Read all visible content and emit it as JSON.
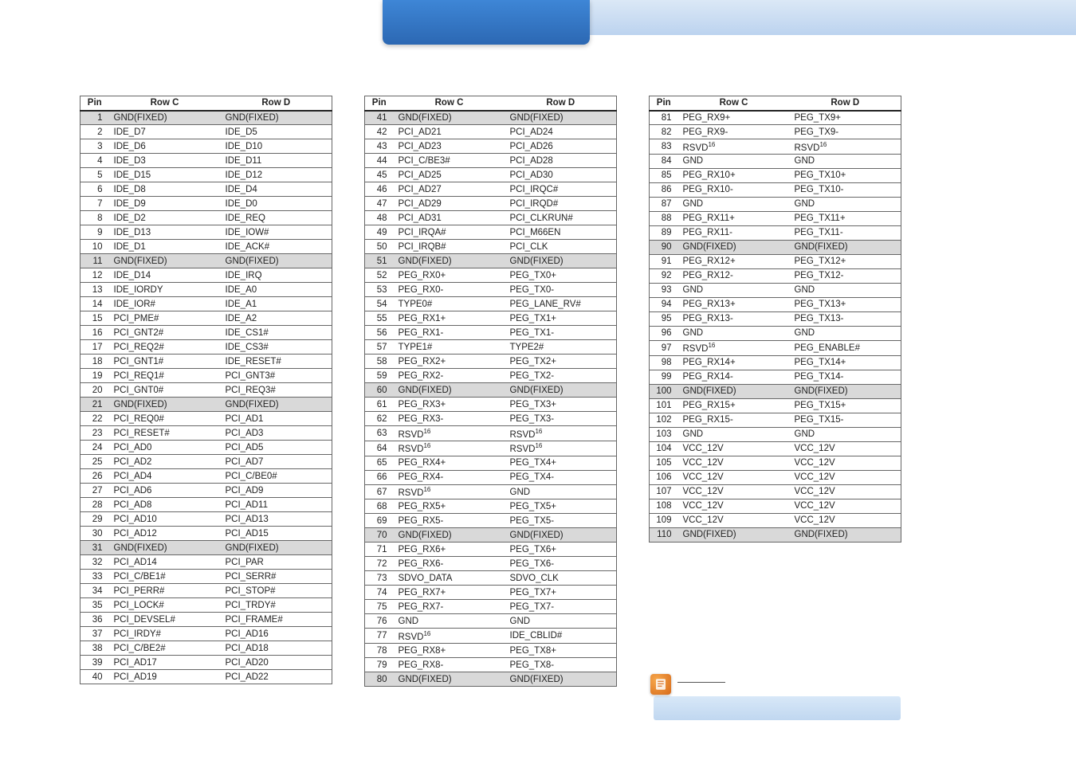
{
  "headers": {
    "pin": "Pin",
    "c": "Row C",
    "d": "Row D"
  },
  "table1": [
    {
      "p": 1,
      "c": "GND(FIXED)",
      "d": "GND(FIXED)",
      "s": 1
    },
    {
      "p": 2,
      "c": "IDE_D7",
      "d": "IDE_D5"
    },
    {
      "p": 3,
      "c": "IDE_D6",
      "d": "IDE_D10"
    },
    {
      "p": 4,
      "c": "IDE_D3",
      "d": "IDE_D11"
    },
    {
      "p": 5,
      "c": "IDE_D15",
      "d": "IDE_D12"
    },
    {
      "p": 6,
      "c": "IDE_D8",
      "d": "IDE_D4"
    },
    {
      "p": 7,
      "c": "IDE_D9",
      "d": "IDE_D0"
    },
    {
      "p": 8,
      "c": "IDE_D2",
      "d": "IDE_REQ"
    },
    {
      "p": 9,
      "c": "IDE_D13",
      "d": "IDE_IOW#"
    },
    {
      "p": 10,
      "c": "IDE_D1",
      "d": "IDE_ACK#"
    },
    {
      "p": 11,
      "c": "GND(FIXED)",
      "d": "GND(FIXED)",
      "s": 1
    },
    {
      "p": 12,
      "c": "IDE_D14",
      "d": "IDE_IRQ"
    },
    {
      "p": 13,
      "c": "IDE_IORDY",
      "d": "IDE_A0"
    },
    {
      "p": 14,
      "c": "IDE_IOR#",
      "d": "IDE_A1"
    },
    {
      "p": 15,
      "c": "PCI_PME#",
      "d": "IDE_A2"
    },
    {
      "p": 16,
      "c": "PCI_GNT2#",
      "d": "IDE_CS1#"
    },
    {
      "p": 17,
      "c": "PCI_REQ2#",
      "d": "IDE_CS3#"
    },
    {
      "p": 18,
      "c": "PCI_GNT1#",
      "d": "IDE_RESET#"
    },
    {
      "p": 19,
      "c": "PCI_REQ1#",
      "d": "PCI_GNT3#"
    },
    {
      "p": 20,
      "c": "PCI_GNT0#",
      "d": "PCI_REQ3#"
    },
    {
      "p": 21,
      "c": "GND(FIXED)",
      "d": "GND(FIXED)",
      "s": 1
    },
    {
      "p": 22,
      "c": "PCI_REQ0#",
      "d": "PCI_AD1"
    },
    {
      "p": 23,
      "c": "PCI_RESET#",
      "d": "PCI_AD3"
    },
    {
      "p": 24,
      "c": "PCI_AD0",
      "d": "PCI_AD5"
    },
    {
      "p": 25,
      "c": "PCI_AD2",
      "d": "PCI_AD7"
    },
    {
      "p": 26,
      "c": "PCI_AD4",
      "d": "PCI_C/BE0#"
    },
    {
      "p": 27,
      "c": "PCI_AD6",
      "d": "PCI_AD9"
    },
    {
      "p": 28,
      "c": "PCI_AD8",
      "d": "PCI_AD11"
    },
    {
      "p": 29,
      "c": "PCI_AD10",
      "d": "PCI_AD13"
    },
    {
      "p": 30,
      "c": "PCI_AD12",
      "d": "PCI_AD15"
    },
    {
      "p": 31,
      "c": "GND(FIXED)",
      "d": "GND(FIXED)",
      "s": 1
    },
    {
      "p": 32,
      "c": "PCI_AD14",
      "d": "PCI_PAR"
    },
    {
      "p": 33,
      "c": "PCI_C/BE1#",
      "d": "PCI_SERR#"
    },
    {
      "p": 34,
      "c": "PCI_PERR#",
      "d": "PCI_STOP#"
    },
    {
      "p": 35,
      "c": "PCI_LOCK#",
      "d": "PCI_TRDY#"
    },
    {
      "p": 36,
      "c": "PCI_DEVSEL#",
      "d": "PCI_FRAME#"
    },
    {
      "p": 37,
      "c": "PCI_IRDY#",
      "d": "PCI_AD16"
    },
    {
      "p": 38,
      "c": "PCI_C/BE2#",
      "d": "PCI_AD18"
    },
    {
      "p": 39,
      "c": "PCI_AD17",
      "d": "PCI_AD20"
    },
    {
      "p": 40,
      "c": "PCI_AD19",
      "d": "PCI_AD22"
    }
  ],
  "table2": [
    {
      "p": 41,
      "c": "GND(FIXED)",
      "d": "GND(FIXED)",
      "s": 1
    },
    {
      "p": 42,
      "c": "PCI_AD21",
      "d": "PCI_AD24"
    },
    {
      "p": 43,
      "c": "PCI_AD23",
      "d": "PCI_AD26"
    },
    {
      "p": 44,
      "c": "PCI_C/BE3#",
      "d": "PCI_AD28"
    },
    {
      "p": 45,
      "c": "PCI_AD25",
      "d": "PCI_AD30"
    },
    {
      "p": 46,
      "c": "PCI_AD27",
      "d": "PCI_IRQC#"
    },
    {
      "p": 47,
      "c": "PCI_AD29",
      "d": "PCI_IRQD#"
    },
    {
      "p": 48,
      "c": "PCI_AD31",
      "d": "PCI_CLKRUN#"
    },
    {
      "p": 49,
      "c": "PCI_IRQA#",
      "d": "PCI_M66EN"
    },
    {
      "p": 50,
      "c": "PCI_IRQB#",
      "d": "PCI_CLK"
    },
    {
      "p": 51,
      "c": "GND(FIXED)",
      "d": "GND(FIXED)",
      "s": 1
    },
    {
      "p": 52,
      "c": "PEG_RX0+",
      "d": "PEG_TX0+"
    },
    {
      "p": 53,
      "c": "PEG_RX0-",
      "d": "PEG_TX0-"
    },
    {
      "p": 54,
      "c": "TYPE0#",
      "d": "PEG_LANE_RV#"
    },
    {
      "p": 55,
      "c": "PEG_RX1+",
      "d": "PEG_TX1+"
    },
    {
      "p": 56,
      "c": "PEG_RX1-",
      "d": "PEG_TX1-"
    },
    {
      "p": 57,
      "c": "TYPE1#",
      "d": "TYPE2#"
    },
    {
      "p": 58,
      "c": "PEG_RX2+",
      "d": "PEG_TX2+"
    },
    {
      "p": 59,
      "c": "PEG_RX2-",
      "d": "PEG_TX2-"
    },
    {
      "p": 60,
      "c": "GND(FIXED)",
      "d": "GND(FIXED)",
      "s": 1
    },
    {
      "p": 61,
      "c": "PEG_RX3+",
      "d": "PEG_TX3+"
    },
    {
      "p": 62,
      "c": "PEG_RX3-",
      "d": "PEG_TX3-"
    },
    {
      "p": 63,
      "c": "RSVD",
      "d": "RSVD",
      "sup": "16"
    },
    {
      "p": 64,
      "c": "RSVD",
      "d": "RSVD",
      "sup": "16"
    },
    {
      "p": 65,
      "c": "PEG_RX4+",
      "d": "PEG_TX4+"
    },
    {
      "p": 66,
      "c": "PEG_RX4-",
      "d": "PEG_TX4-"
    },
    {
      "p": 67,
      "c": "RSVD",
      "d": "GND",
      "sup_c": "16"
    },
    {
      "p": 68,
      "c": "PEG_RX5+",
      "d": "PEG_TX5+"
    },
    {
      "p": 69,
      "c": "PEG_RX5-",
      "d": "PEG_TX5-"
    },
    {
      "p": 70,
      "c": "GND(FIXED)",
      "d": "GND(FIXED)",
      "s": 1
    },
    {
      "p": 71,
      "c": "PEG_RX6+",
      "d": "PEG_TX6+"
    },
    {
      "p": 72,
      "c": "PEG_RX6-",
      "d": "PEG_TX6-"
    },
    {
      "p": 73,
      "c": "SDVO_DATA",
      "d": "SDVO_CLK"
    },
    {
      "p": 74,
      "c": "PEG_RX7+",
      "d": "PEG_TX7+"
    },
    {
      "p": 75,
      "c": "PEG_RX7-",
      "d": "PEG_TX7-"
    },
    {
      "p": 76,
      "c": "GND",
      "d": "GND"
    },
    {
      "p": 77,
      "c": "RSVD",
      "d": "IDE_CBLID#",
      "sup_c": "16"
    },
    {
      "p": 78,
      "c": "PEG_RX8+",
      "d": "PEG_TX8+"
    },
    {
      "p": 79,
      "c": "PEG_RX8-",
      "d": "PEG_TX8-"
    },
    {
      "p": 80,
      "c": "GND(FIXED)",
      "d": "GND(FIXED)",
      "s": 1
    }
  ],
  "table3": [
    {
      "p": 81,
      "c": "PEG_RX9+",
      "d": "PEG_TX9+"
    },
    {
      "p": 82,
      "c": "PEG_RX9-",
      "d": "PEG_TX9-"
    },
    {
      "p": 83,
      "c": "RSVD",
      "d": "RSVD",
      "sup": "16"
    },
    {
      "p": 84,
      "c": "GND",
      "d": "GND"
    },
    {
      "p": 85,
      "c": "PEG_RX10+",
      "d": "PEG_TX10+"
    },
    {
      "p": 86,
      "c": "PEG_RX10-",
      "d": "PEG_TX10-"
    },
    {
      "p": 87,
      "c": "GND",
      "d": "GND"
    },
    {
      "p": 88,
      "c": "PEG_RX11+",
      "d": "PEG_TX11+"
    },
    {
      "p": 89,
      "c": "PEG_RX11-",
      "d": "PEG_TX11-"
    },
    {
      "p": 90,
      "c": "GND(FIXED)",
      "d": "GND(FIXED)",
      "s": 1
    },
    {
      "p": 91,
      "c": "PEG_RX12+",
      "d": "PEG_TX12+"
    },
    {
      "p": 92,
      "c": "PEG_RX12-",
      "d": "PEG_TX12-"
    },
    {
      "p": 93,
      "c": "GND",
      "d": "GND"
    },
    {
      "p": 94,
      "c": "PEG_RX13+",
      "d": "PEG_TX13+"
    },
    {
      "p": 95,
      "c": "PEG_RX13-",
      "d": "PEG_TX13-"
    },
    {
      "p": 96,
      "c": "GND",
      "d": "GND"
    },
    {
      "p": 97,
      "c": "RSVD",
      "d": "PEG_ENABLE#",
      "sup_c": "16"
    },
    {
      "p": 98,
      "c": "PEG_RX14+",
      "d": "PEG_TX14+"
    },
    {
      "p": 99,
      "c": "PEG_RX14-",
      "d": "PEG_TX14-"
    },
    {
      "p": 100,
      "c": "GND(FIXED)",
      "d": "GND(FIXED)",
      "s": 1
    },
    {
      "p": 101,
      "c": "PEG_RX15+",
      "d": "PEG_TX15+"
    },
    {
      "p": 102,
      "c": "PEG_RX15-",
      "d": "PEG_TX15-"
    },
    {
      "p": 103,
      "c": "GND",
      "d": "GND"
    },
    {
      "p": 104,
      "c": "VCC_12V",
      "d": "VCC_12V"
    },
    {
      "p": 105,
      "c": "VCC_12V",
      "d": "VCC_12V"
    },
    {
      "p": 106,
      "c": "VCC_12V",
      "d": "VCC_12V"
    },
    {
      "p": 107,
      "c": "VCC_12V",
      "d": "VCC_12V"
    },
    {
      "p": 108,
      "c": "VCC_12V",
      "d": "VCC_12V"
    },
    {
      "p": 109,
      "c": "VCC_12V",
      "d": "VCC_12V"
    },
    {
      "p": 110,
      "c": "GND(FIXED)",
      "d": "GND(FIXED)",
      "s": 1
    }
  ]
}
